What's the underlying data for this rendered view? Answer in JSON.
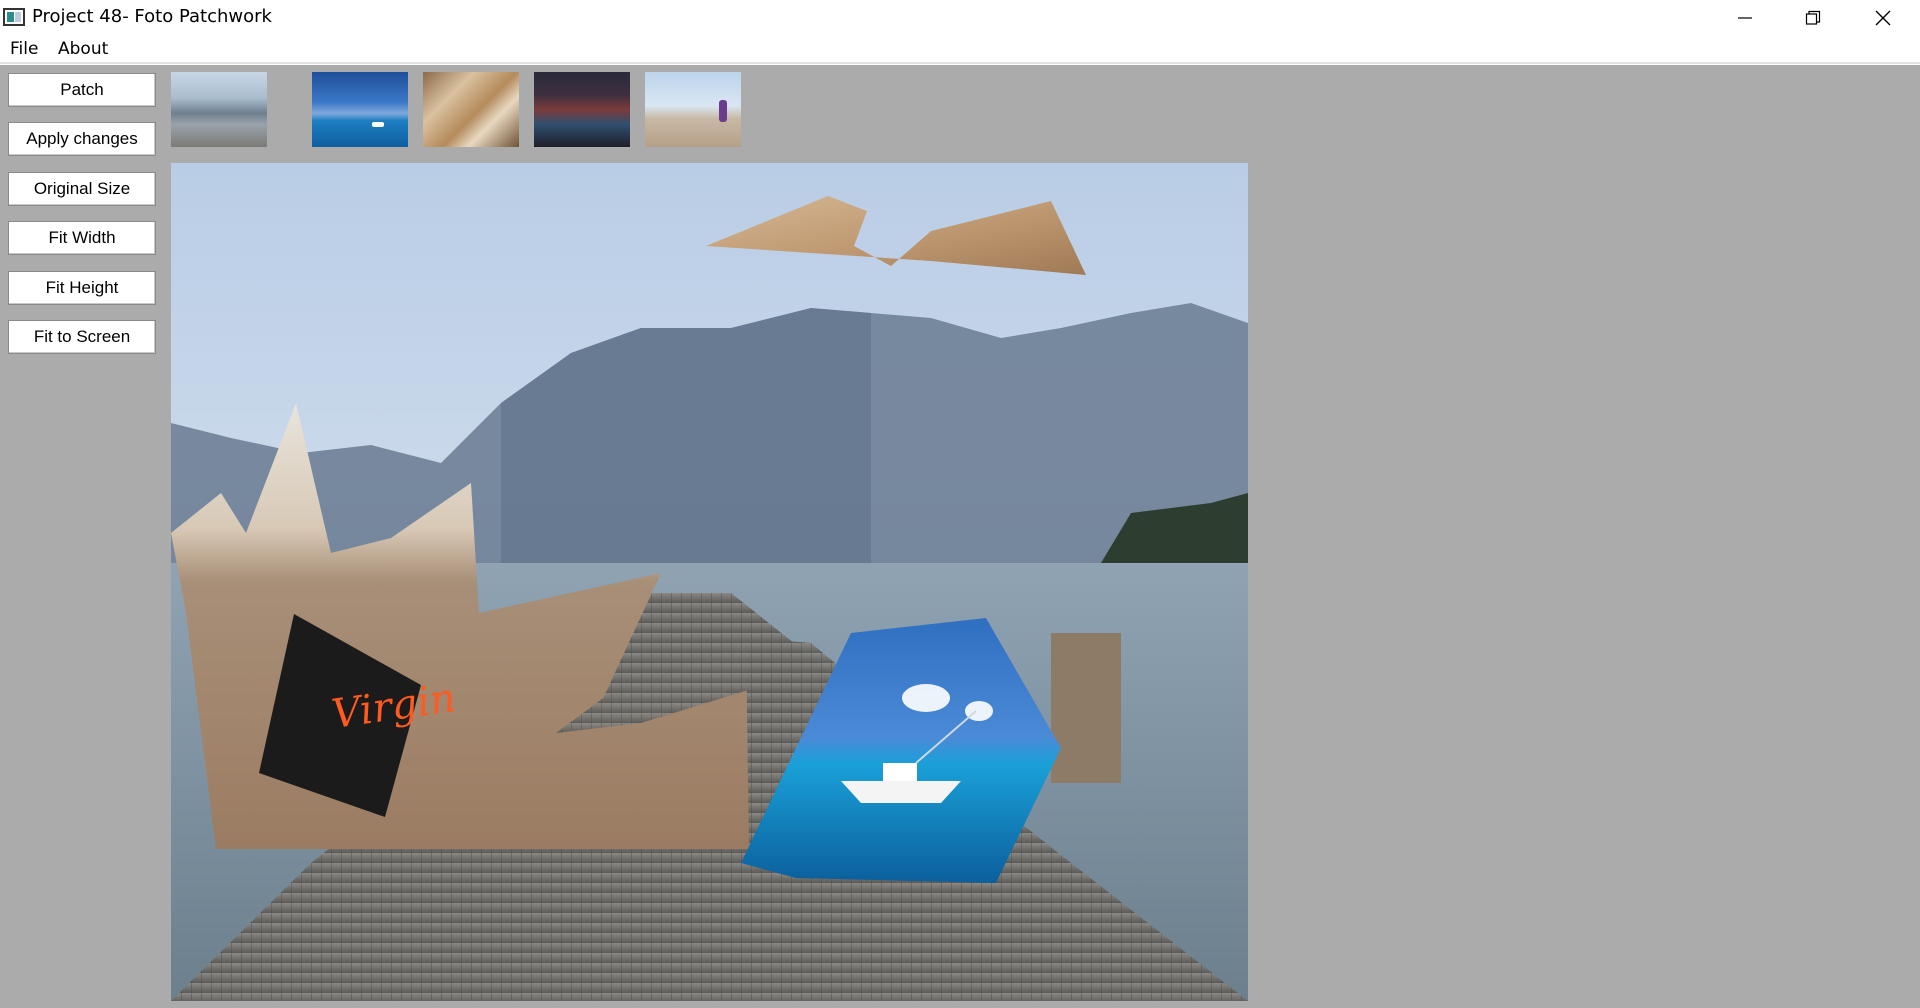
{
  "window": {
    "title": "Project 48- Foto Patchwork"
  },
  "menu": {
    "items": [
      {
        "label": "File"
      },
      {
        "label": "About"
      }
    ]
  },
  "toolbar": {
    "buttons": [
      {
        "label": "Patch"
      },
      {
        "label": "Apply changes"
      },
      {
        "label": "Original Size"
      },
      {
        "label": "Fit Width"
      },
      {
        "label": "Fit Height"
      },
      {
        "label": "Fit to Screen"
      }
    ]
  },
  "canvas": {
    "patch_text": "Virgin"
  },
  "colors": {
    "client_bg": "#ababab",
    "button_bg": "#ffffff",
    "title_bar_bg": "#ffffff"
  }
}
